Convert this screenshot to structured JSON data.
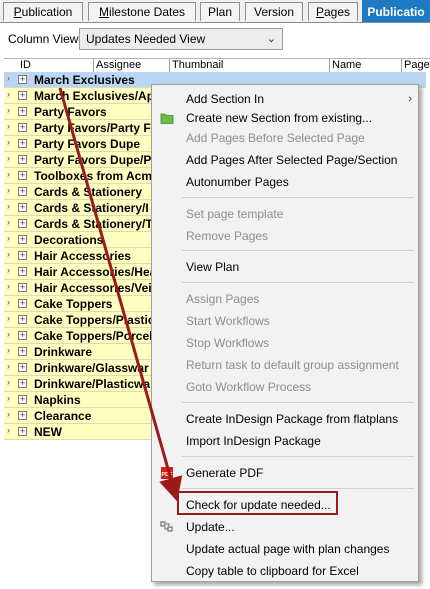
{
  "tabs": [
    {
      "label": "Publication",
      "underline": "P",
      "rest": "ublication"
    },
    {
      "label": "Milestone Dates",
      "underline": "M",
      "rest": "ilestone Dates"
    },
    {
      "label": "Plan",
      "underline": "",
      "rest": "Plan"
    },
    {
      "label": "Version",
      "underline": "",
      "rest": "Version"
    },
    {
      "label": "Pages",
      "underline": "P",
      "rest": "ages"
    },
    {
      "label": "Publicatio",
      "underline": "",
      "rest": "Publicatio"
    }
  ],
  "column_view": {
    "label": "Column View:",
    "value": "Updates Needed View"
  },
  "columns": [
    "ID",
    "Assignee",
    "Thumbnail",
    "Name",
    "Page"
  ],
  "rows": [
    "March Exclusives",
    "March Exclusives/Ap",
    "Party Favors",
    "Party Favors/Party F",
    "Party Favors Dupe",
    "Party Favors Dupe/P",
    "Toolboxes from Acm",
    "Cards & Stationery",
    "Cards & Stationery/I",
    "Cards & Stationery/T",
    "Decorations",
    "Hair Accessories",
    "Hair Accessories/Hea",
    "Hair Accessories/Veil",
    "Cake Toppers",
    "Cake Toppers/Plastic",
    "Cake Toppers/Porcel",
    "Drinkware",
    "Drinkware/Glasswar",
    "Drinkware/Plasticwa",
    "Napkins",
    "Clearance",
    "NEW"
  ],
  "menu": {
    "add_section_in": "Add Section In",
    "create_new_section": "Create new Section from existing...",
    "add_pages_before": "Add Pages Before Selected Page",
    "add_pages_after": "Add Pages After Selected Page/Section",
    "autonumber_pages": "Autonumber Pages",
    "set_page_template": "Set page template",
    "remove_pages": "Remove Pages",
    "view_plan": "View Plan",
    "assign_pages": "Assign Pages",
    "start_workflows": "Start Workflows",
    "stop_workflows": "Stop Workflows",
    "return_task": "Return task to default group assignment",
    "goto_workflow": "Goto Workflow Process",
    "create_indesign": "Create InDesign Package from flatplans",
    "import_indesign": "Import InDesign Package",
    "generate_pdf": "Generate PDF",
    "check_update": "Check for update needed...",
    "update": "Update...",
    "update_actual": "Update actual page with plan changes",
    "copy_table": "Copy table to clipboard for Excel"
  },
  "pdf_icon_text": "PDF",
  "colors": {
    "accent_tab": "#1f7ac4",
    "row_bg": "#ffffc2",
    "selected_row": "#b9d7f5",
    "annotation": "#9b1b1b"
  }
}
